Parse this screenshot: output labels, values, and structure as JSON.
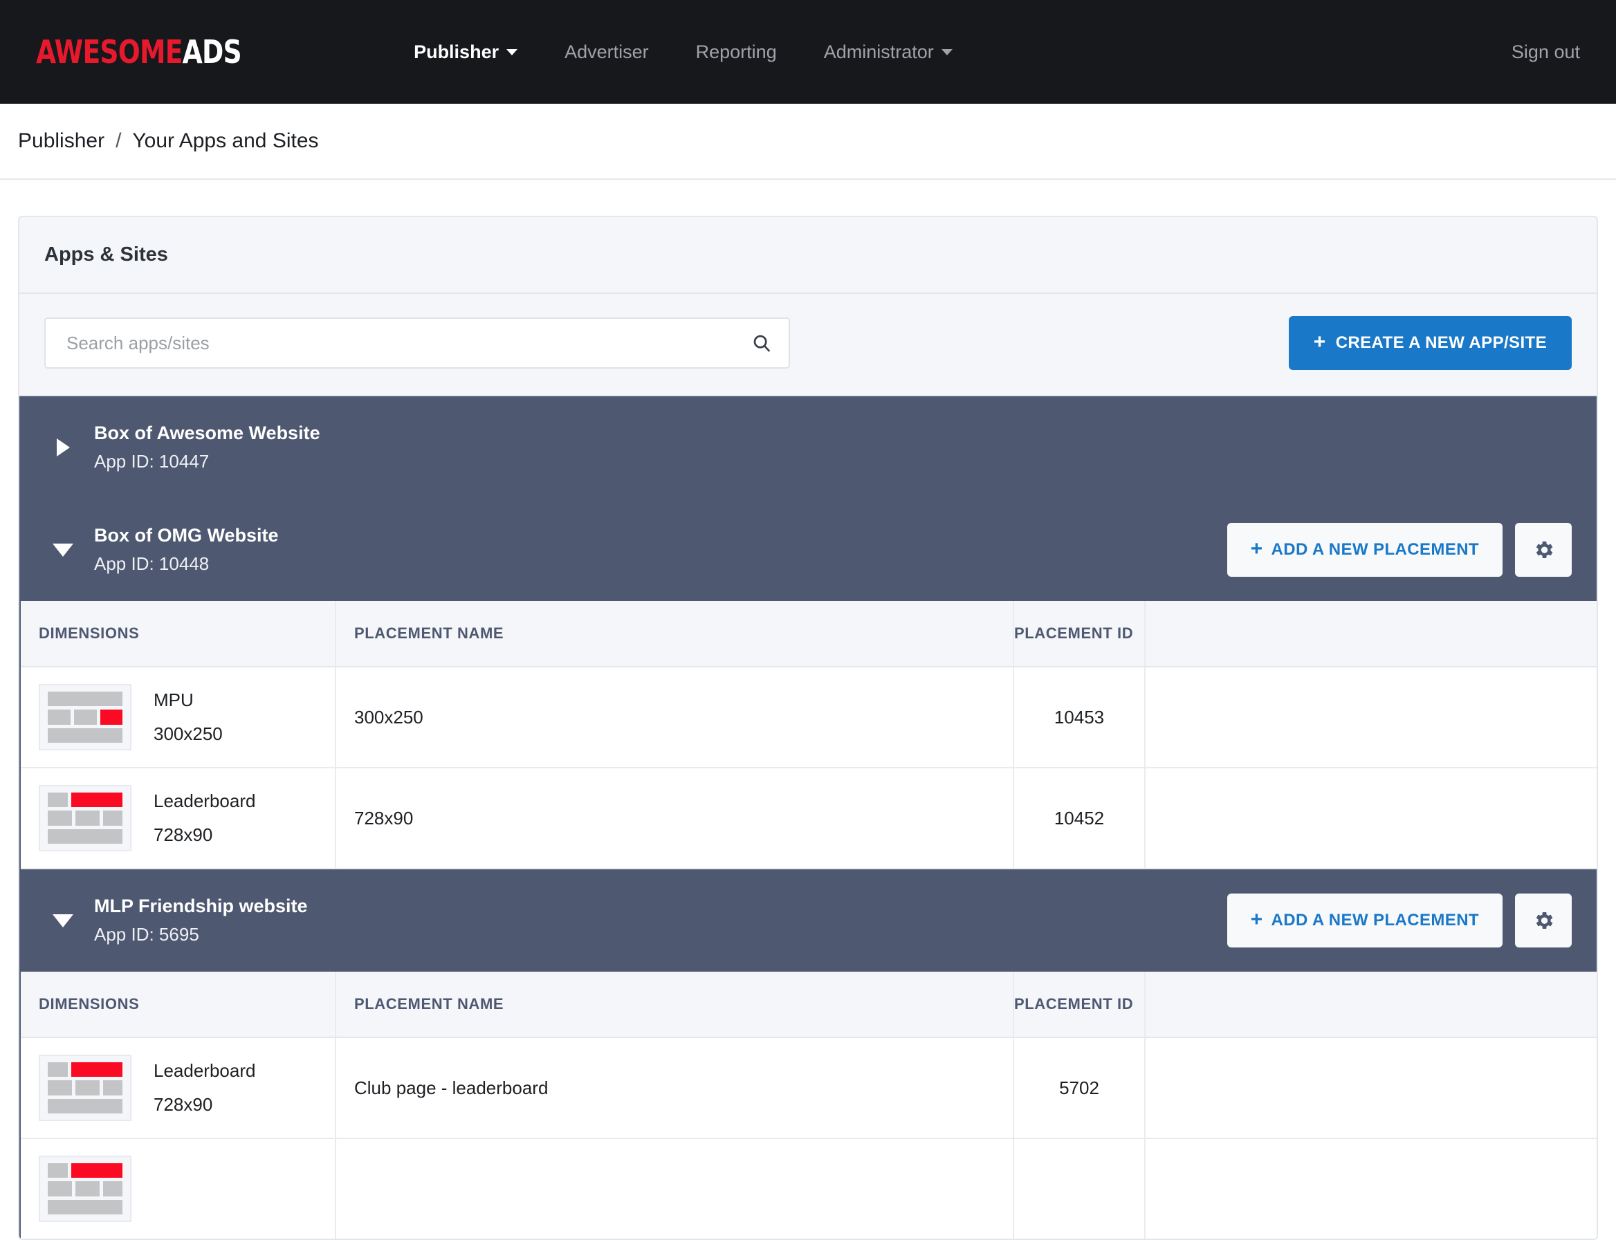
{
  "brand": {
    "name_part1": "AWESOME",
    "name_part2": "ADS"
  },
  "nav": {
    "items": [
      {
        "label": "Publisher",
        "has_caret": true,
        "active": true
      },
      {
        "label": "Advertiser",
        "has_caret": false,
        "active": false
      },
      {
        "label": "Reporting",
        "has_caret": false,
        "active": false
      },
      {
        "label": "Administrator",
        "has_caret": true,
        "active": false
      }
    ],
    "sign_out": "Sign out"
  },
  "breadcrumb": {
    "parent": "Publisher",
    "separator": "/",
    "current": "Your Apps and Sites"
  },
  "panel": {
    "title": "Apps & Sites"
  },
  "toolbar": {
    "search_placeholder": "Search apps/sites",
    "search_value": "",
    "create_button": "CREATE A NEW APP/SITE",
    "plus": "+"
  },
  "table_headers": {
    "dimensions": "DIMENSIONS",
    "placement_name": "PLACEMENT NAME",
    "placement_id": "PLACEMENT ID"
  },
  "add_placement_label": "ADD A NEW PLACEMENT",
  "apps": [
    {
      "name": "Box of Awesome Website",
      "app_id_label": "App ID: 10447",
      "expanded": false,
      "placements": []
    },
    {
      "name": "Box of OMG Website",
      "app_id_label": "App ID: 10448",
      "expanded": true,
      "placements": [
        {
          "type": "mpu",
          "dimension_name": "MPU",
          "dimension_size": "300x250",
          "placement_name": "300x250",
          "placement_id": "10453"
        },
        {
          "type": "leaderboard",
          "dimension_name": "Leaderboard",
          "dimension_size": "728x90",
          "placement_name": "728x90",
          "placement_id": "10452"
        }
      ]
    },
    {
      "name": "MLP Friendship website",
      "app_id_label": "App ID: 5695",
      "expanded": true,
      "placements": [
        {
          "type": "leaderboard",
          "dimension_name": "Leaderboard",
          "dimension_size": "728x90",
          "placement_name": "Club page - leaderboard",
          "placement_id": "5702"
        },
        {
          "type": "leaderboard",
          "dimension_name": "",
          "dimension_size": "",
          "placement_name": "",
          "placement_id": "",
          "partial": true
        }
      ]
    }
  ],
  "colors": {
    "navbar_bg": "#17181c",
    "brand_red": "#e8192c",
    "app_header_bg": "#4e5871",
    "primary_blue": "#1a78c8",
    "panel_bg": "#f4f6f9",
    "ad_red": "#fa0a23"
  },
  "icons": {
    "search": "search-icon",
    "gear": "gear-icon",
    "caret": "chevron-down-icon"
  }
}
